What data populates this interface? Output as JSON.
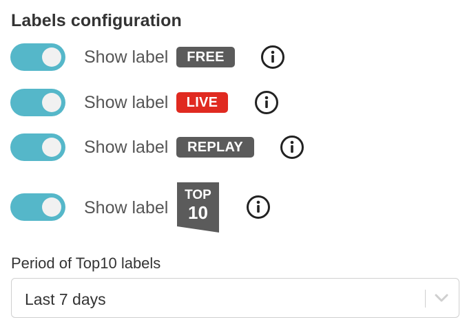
{
  "section": {
    "title": "Labels configuration"
  },
  "rows": [
    {
      "label": "Show label",
      "badge": "FREE",
      "badge_color": "#5b5b5b",
      "enabled": true
    },
    {
      "label": "Show label",
      "badge": "LIVE",
      "badge_color": "#e02a20",
      "enabled": true
    },
    {
      "label": "Show label",
      "badge": "REPLAY",
      "badge_color": "#5b5b5b",
      "enabled": true
    },
    {
      "label": "Show label",
      "badge_line1": "TOP",
      "badge_line2": "10",
      "badge_color": "#5b5b5b",
      "enabled": true
    }
  ],
  "toggle_color": "#55b7c9",
  "icons": {
    "info": "info-circle-icon",
    "chevron": "chevron-down-icon"
  },
  "period": {
    "label": "Period of Top10 labels",
    "selected": "Last 7 days"
  }
}
